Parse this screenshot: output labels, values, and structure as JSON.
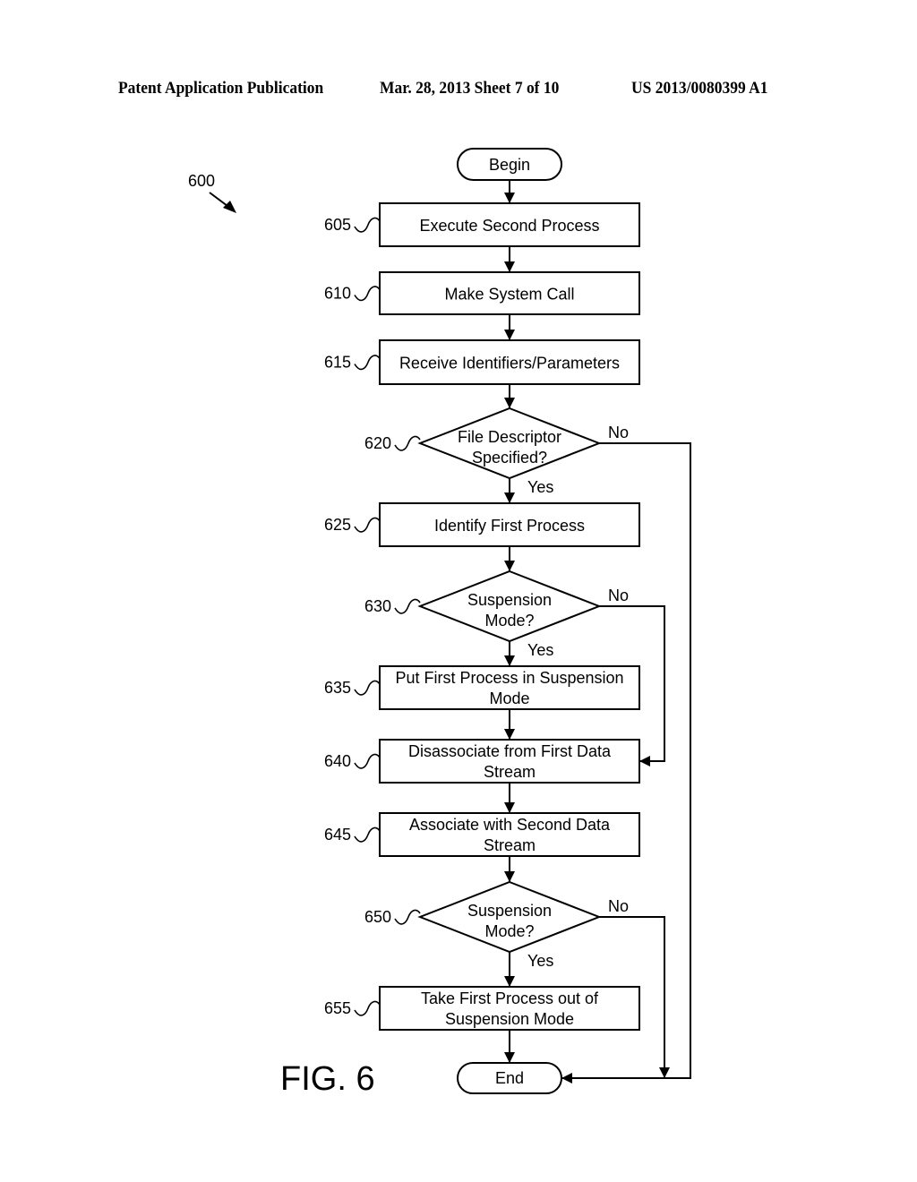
{
  "header": {
    "publication": "Patent Application Publication",
    "date_sheet": "Mar. 28, 2013  Sheet 7 of 10",
    "patent_number": "US 2013/0080399 A1"
  },
  "figure": {
    "label": "FIG. 6",
    "reference": "600"
  },
  "flowchart": {
    "begin": "Begin",
    "end": "End",
    "steps": [
      {
        "id": "605",
        "type": "process",
        "lines": [
          "Execute Second Process"
        ]
      },
      {
        "id": "610",
        "type": "process",
        "lines": [
          "Make System Call"
        ]
      },
      {
        "id": "615",
        "type": "process",
        "lines": [
          "Receive Identifiers/Parameters"
        ]
      },
      {
        "id": "620",
        "type": "decision",
        "lines": [
          "File Descriptor",
          "Specified?"
        ],
        "yes": "Yes",
        "no": "No"
      },
      {
        "id": "625",
        "type": "process",
        "lines": [
          "Identify First Process"
        ]
      },
      {
        "id": "630",
        "type": "decision",
        "lines": [
          "Suspension",
          "Mode?"
        ],
        "yes": "Yes",
        "no": "No"
      },
      {
        "id": "635",
        "type": "process",
        "lines": [
          "Put First Process in Suspension",
          "Mode"
        ]
      },
      {
        "id": "640",
        "type": "process",
        "lines": [
          "Disassociate from First Data",
          "Stream"
        ]
      },
      {
        "id": "645",
        "type": "process",
        "lines": [
          "Associate with Second Data",
          "Stream"
        ]
      },
      {
        "id": "650",
        "type": "decision",
        "lines": [
          "Suspension",
          "Mode?"
        ],
        "yes": "Yes",
        "no": "No"
      },
      {
        "id": "655",
        "type": "process",
        "lines": [
          "Take First Process out of",
          "Suspension Mode"
        ]
      }
    ],
    "edges": [
      {
        "from": "begin",
        "to": "605"
      },
      {
        "from": "605",
        "to": "610"
      },
      {
        "from": "610",
        "to": "615"
      },
      {
        "from": "615",
        "to": "620"
      },
      {
        "from": "620",
        "to": "625",
        "label": "Yes"
      },
      {
        "from": "620",
        "to": "end",
        "label": "No"
      },
      {
        "from": "625",
        "to": "630"
      },
      {
        "from": "630",
        "to": "635",
        "label": "Yes"
      },
      {
        "from": "630",
        "to": "640",
        "label": "No"
      },
      {
        "from": "635",
        "to": "640"
      },
      {
        "from": "640",
        "to": "645"
      },
      {
        "from": "645",
        "to": "650"
      },
      {
        "from": "650",
        "to": "655",
        "label": "Yes"
      },
      {
        "from": "650",
        "to": "end",
        "label": "No"
      },
      {
        "from": "655",
        "to": "end"
      }
    ]
  }
}
